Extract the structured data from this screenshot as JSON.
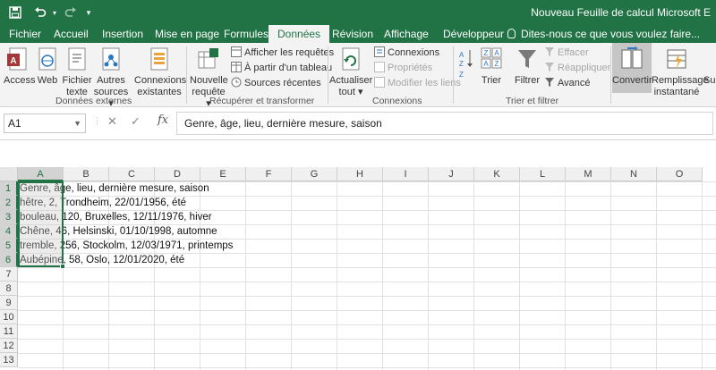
{
  "window": {
    "title": "Nouveau Feuille de calcul Microsoft E"
  },
  "tabs": [
    {
      "label": "Fichier"
    },
    {
      "label": "Accueil"
    },
    {
      "label": "Insertion"
    },
    {
      "label": "Mise en page"
    },
    {
      "label": "Formules"
    },
    {
      "label": "Données"
    },
    {
      "label": "Révision"
    },
    {
      "label": "Affichage"
    },
    {
      "label": "Développeur"
    }
  ],
  "tell_me": "Dites-nous ce que vous voulez faire...",
  "ribbon": {
    "donnees_externes": {
      "group_label": "Données externes",
      "access": "Access",
      "web": "Web",
      "fichier_texte_1": "Fichier",
      "fichier_texte_2": "texte",
      "autres_sources_1": "Autres",
      "autres_sources_2": "sources",
      "connexions_existantes_1": "Connexions",
      "connexions_existantes_2": "existantes"
    },
    "recuperer": {
      "group_label": "Récupérer et transformer",
      "nouvelle_requete_1": "Nouvelle",
      "nouvelle_requete_2": "requête",
      "afficher_requetes": "Afficher les requêtes",
      "a_partir_tableau": "À partir d'un tableau",
      "sources_recentes": "Sources récentes"
    },
    "connexions": {
      "group_label": "Connexions",
      "actualiser_1": "Actualiser",
      "actualiser_2": "tout",
      "connexions": "Connexions",
      "proprietes": "Propriétés",
      "modifier_liens": "Modifier les liens"
    },
    "trier_filtrer": {
      "group_label": "Trier et filtrer",
      "trier": "Trier",
      "filtrer": "Filtrer",
      "effacer": "Effacer",
      "reappliquer": "Réappliquer",
      "avance": "Avancé"
    },
    "outils": {
      "convertir": "Convertir",
      "remplissage_1": "Remplissage",
      "remplissage_2": "instantané",
      "suppr_partial": "Su"
    }
  },
  "formula_bar": {
    "name_box": "A1",
    "cancel": "✕",
    "enter": "✓",
    "fx": "fx",
    "content": "Genre, âge, lieu, dernière mesure, saison"
  },
  "sheet": {
    "columns": [
      "A",
      "B",
      "C",
      "D",
      "E",
      "F",
      "G",
      "H",
      "I",
      "J",
      "K",
      "L",
      "M",
      "N",
      "O"
    ],
    "rows": [
      "1",
      "2",
      "3",
      "4",
      "5",
      "6",
      "7",
      "8",
      "9",
      "10",
      "11",
      "12",
      "13"
    ],
    "cells": [
      "Genre, âge, lieu, dernière mesure, saison",
      "hêtre, 2, Trondheim, 22/01/1956, été",
      "bouleau, 120, Bruxelles, 12/11/1976, hiver",
      "Chêne, 46, Helsinski, 01/10/1998, automne",
      "tremble, 256, Stockolm, 12/03/1971, printemps",
      "Aubépine, 58, Oslo, 12/01/2020, été"
    ]
  },
  "colors": {
    "accent": "#217346"
  }
}
